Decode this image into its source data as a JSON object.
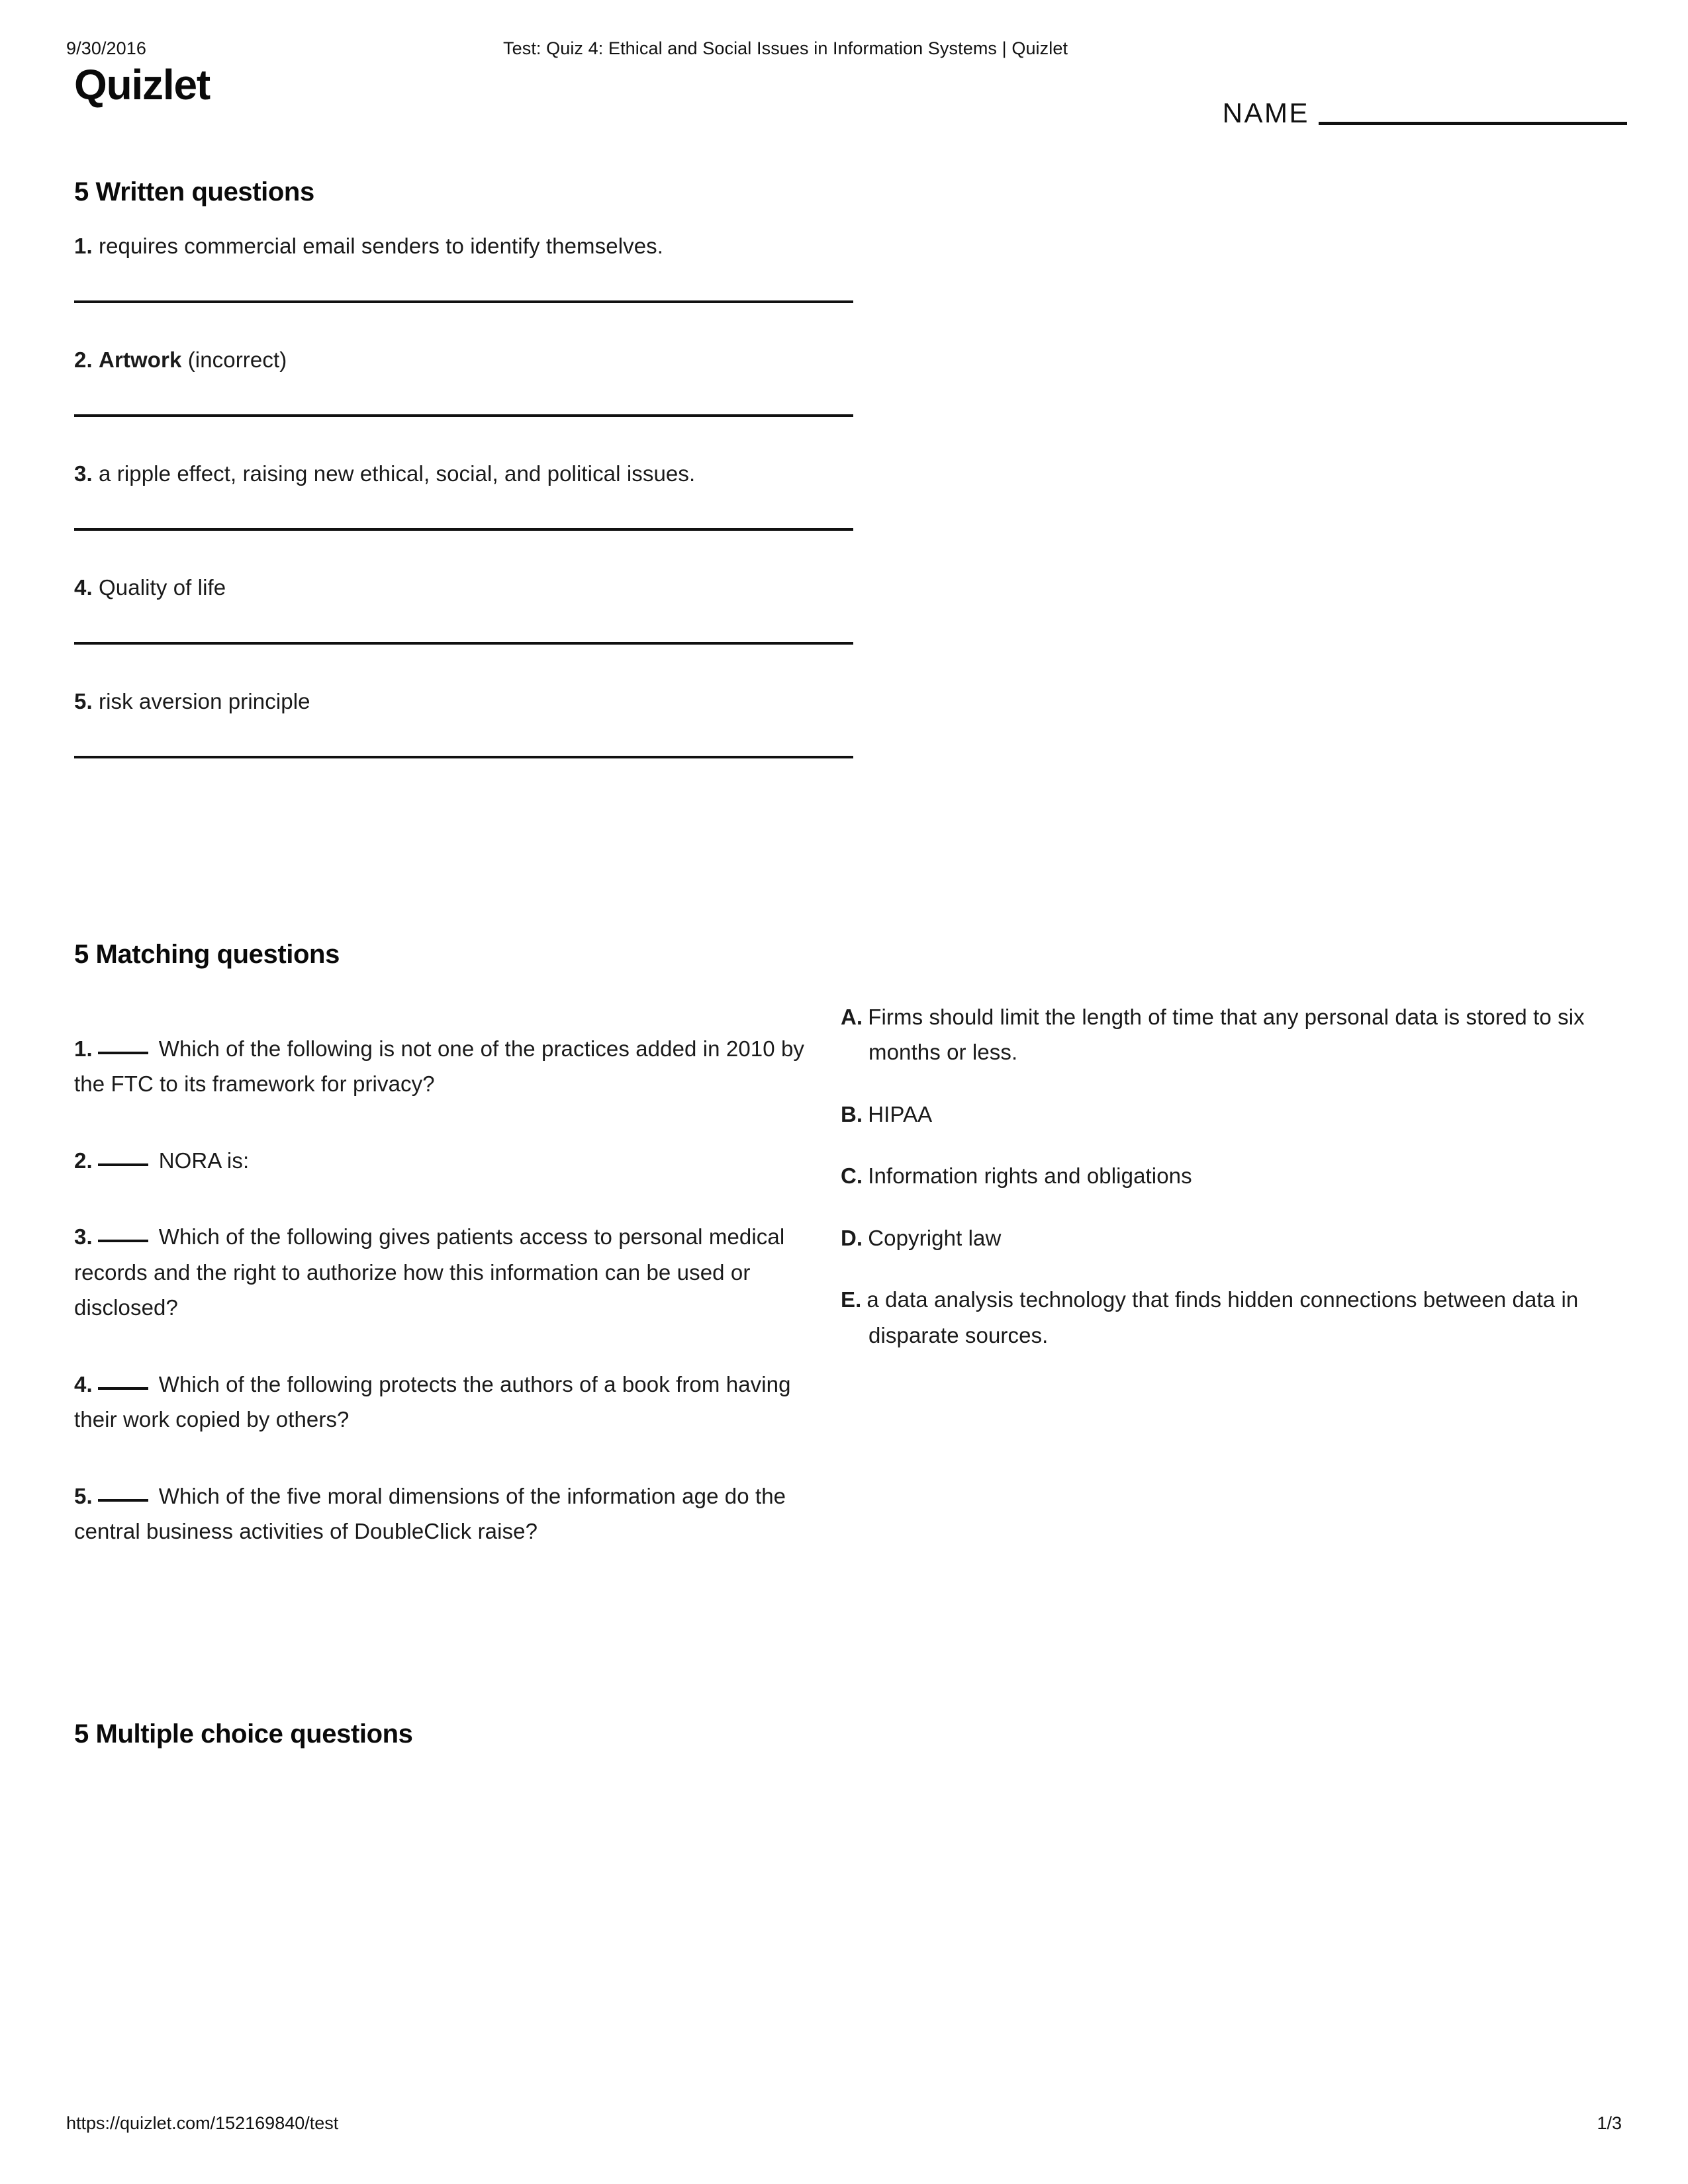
{
  "header": {
    "date": "9/30/2016",
    "document_title": "Test: Quiz 4: Ethical and Social Issues in Information Systems | Quizlet",
    "brand": "Quizlet",
    "name_label": "NAME"
  },
  "sections": {
    "written": {
      "heading": "5 Written questions",
      "questions": [
        {
          "number": "1.",
          "text": "requires commercial email senders to identify themselves.",
          "bold_term": "",
          "suffix": ""
        },
        {
          "number": "2.",
          "text": "",
          "bold_term": "Artwork",
          "suffix": "(incorrect)"
        },
        {
          "number": "3.",
          "text": "a ripple effect, raising new ethical, social, and political issues.",
          "bold_term": "",
          "suffix": ""
        },
        {
          "number": "4.",
          "text": "Quality of life",
          "bold_term": "",
          "suffix": ""
        },
        {
          "number": "5.",
          "text": "risk aversion principle",
          "bold_term": "",
          "suffix": ""
        }
      ]
    },
    "matching": {
      "heading": "5 Matching questions",
      "questions": [
        {
          "number": "1.",
          "text": "Which of the following is not one of the practices added in 2010 by the FTC to its framework for privacy?"
        },
        {
          "number": "2.",
          "text": "NORA is:"
        },
        {
          "number": "3.",
          "text": "Which of the following gives patients access to personal medical records and the right to authorize how this information can be used or disclosed?"
        },
        {
          "number": "4.",
          "text": "Which of the following protects the authors of a book from having their work copied by others?"
        },
        {
          "number": "5.",
          "text": "Which of the five moral dimensions of the information age do the central business activities of DoubleClick raise?"
        }
      ],
      "options": [
        {
          "letter": "A.",
          "text": "Firms should limit the length of time that any personal data is stored to six months or less."
        },
        {
          "letter": "B.",
          "text": "HIPAA"
        },
        {
          "letter": "C.",
          "text": "Information rights and obligations"
        },
        {
          "letter": "D.",
          "text": "Copyright law"
        },
        {
          "letter": "E.",
          "text": "a data analysis technology that finds hidden connections between data in disparate sources."
        }
      ]
    },
    "multiple_choice": {
      "heading": "5 Multiple choice questions"
    }
  },
  "footer": {
    "url": "https://quizlet.com/152169840/test",
    "page": "1/3"
  }
}
